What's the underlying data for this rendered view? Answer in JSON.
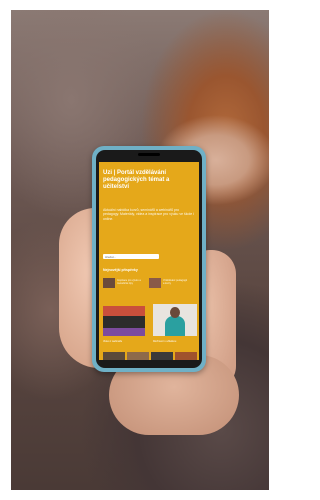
{
  "screen": {
    "title": "Uzi | Portál vzdělávání pedagogických témat a učitelství",
    "description": "Aktuální nabídka kurzů, seminářů a webinářů pro pedagogy. Materiály, videa a inspirace pro výuku ve škole i online.",
    "search_placeholder": "Hledat...",
    "section_label": "Nejnovější příspěvky",
    "cards": [
      {
        "text": "Inspirace pro výuku a metodické tipy"
      },
      {
        "text": "Vzdělávání pedagogů a kurzy"
      }
    ],
    "captions": [
      "Video z webináře",
      "Rozhovor s učitelkou"
    ]
  },
  "colors": {
    "accent": "#e5a81a",
    "phone_case": "#6fb0c6"
  }
}
